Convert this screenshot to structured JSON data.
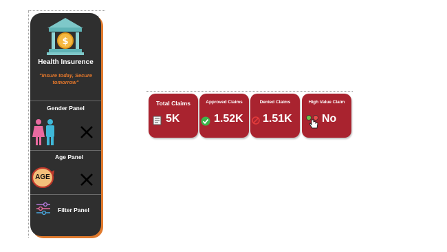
{
  "nav": {
    "app_title": "Health Insurence",
    "tagline": "\"Insure today, Secure tomorrow\"",
    "logo_icon": "bank-dollar-icon",
    "gender_panel": {
      "label": "Gender Panel",
      "icon": "man-woman-icon",
      "clear_icon": "x-icon"
    },
    "age_panel": {
      "label": "Age Panel",
      "icon": "age-badge-icon",
      "badge_text": "AGE",
      "clear_icon": "x-icon"
    },
    "filter_panel": {
      "label": "Filter Panel",
      "icon": "sliders-icon"
    },
    "more_options": "..."
  },
  "cards": [
    {
      "title": "Total Claims",
      "value": "5K",
      "icon": "document-icon"
    },
    {
      "title": "Approved Claims",
      "value": "1.52K",
      "icon": "check-circle-icon"
    },
    {
      "title": "Denied Claims",
      "value": "1.51K",
      "icon": "no-entry-icon"
    },
    {
      "title": "High Value Claim",
      "value": "No",
      "icon": "hand-click-icon"
    }
  ],
  "colors": {
    "panel_bg": "#2f2f2f",
    "accent_orange": "#e8792b",
    "card_red": "#a9232f"
  }
}
